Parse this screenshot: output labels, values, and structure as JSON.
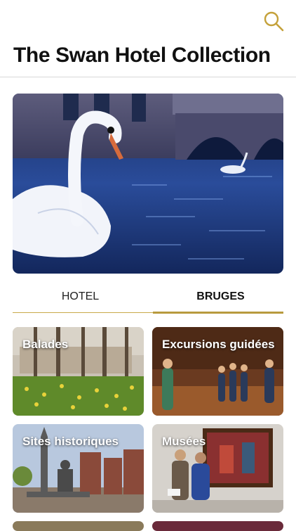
{
  "header": {
    "title": "The Swan Hotel Collection",
    "search_icon": "search-icon",
    "accent_color": "#c4a13a"
  },
  "tabs": [
    {
      "label": "HOTEL",
      "active": false
    },
    {
      "label": "BRUGES",
      "active": true
    }
  ],
  "cards": [
    {
      "label": "Balades"
    },
    {
      "label": "Excursions guidées"
    },
    {
      "label": "Sites historiques"
    },
    {
      "label": "Musées"
    }
  ]
}
